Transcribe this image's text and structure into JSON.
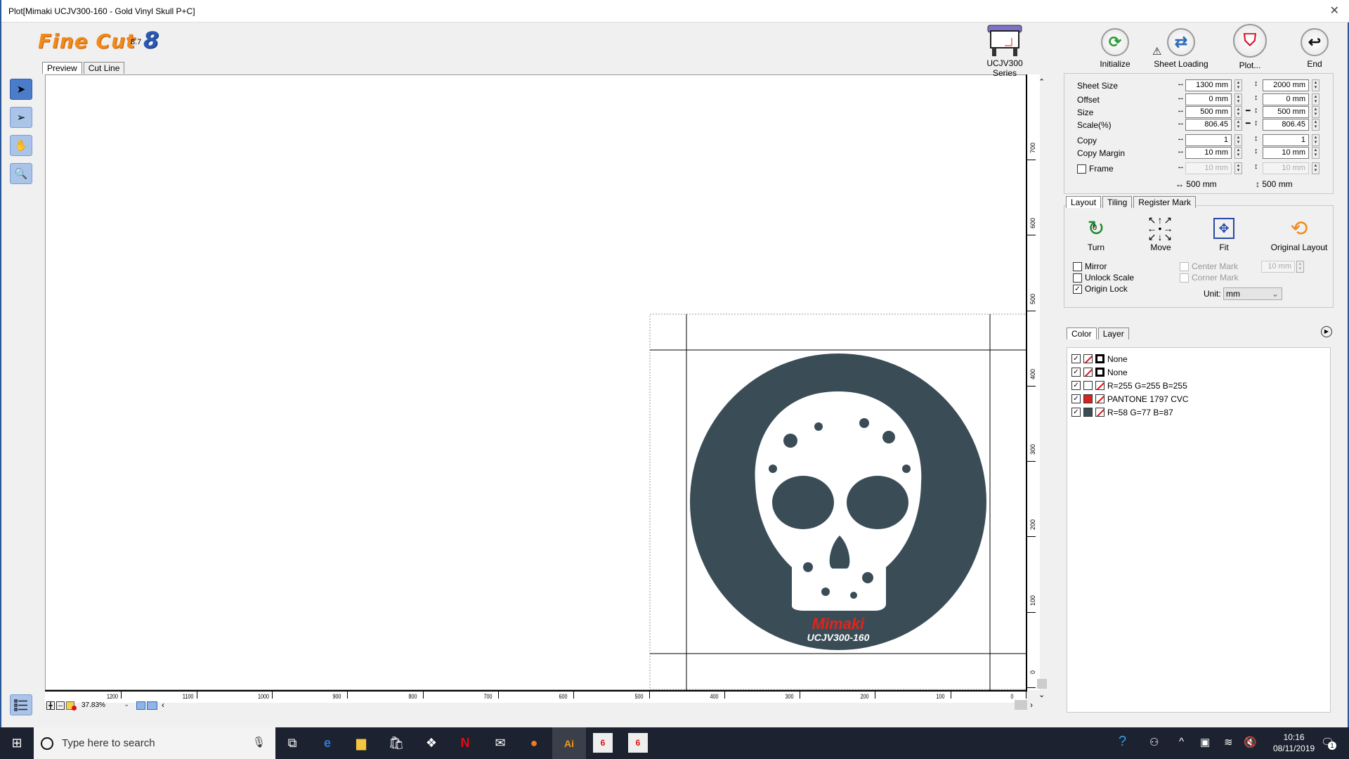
{
  "window": {
    "title": "Plot[Mimaki UCJV300-160 - Gold Vinyl Skull P+C]",
    "close_glyph": "✕"
  },
  "app": {
    "logo_text": "Fine Cut ",
    "logo_number": "8",
    "version": "8.7"
  },
  "view_tabs": [
    {
      "label": "Preview",
      "active": true
    },
    {
      "label": "Cut Line",
      "active": false
    }
  ],
  "left_tools": [
    {
      "name": "select-tool",
      "icon": "arrow-pointer",
      "selected": true
    },
    {
      "name": "direct-select-tool",
      "icon": "arrow-pointer-outline",
      "selected": false
    },
    {
      "name": "hand-tool",
      "icon": "hand",
      "selected": false
    },
    {
      "name": "zoom-tool",
      "icon": "magnifier",
      "selected": false
    }
  ],
  "device": {
    "label": "UCJV300 Series"
  },
  "top_buttons": [
    {
      "label": "Initialize",
      "icon": "refresh-icon",
      "color": "#2e9d3a"
    },
    {
      "label": "Sheet Loading",
      "icon": "swap-arrows-icon",
      "color": "#2f6db8",
      "warning": true
    },
    {
      "label": "Plot...",
      "icon": "plot-icon",
      "color": "#d3122c"
    },
    {
      "label": "End",
      "icon": "return-arrow-icon",
      "color": "#111111"
    }
  ],
  "settings": {
    "rows": [
      {
        "label": "Sheet Size",
        "h": "1300 mm",
        "v": "2000 mm",
        "link": false,
        "disabled": false
      },
      {
        "label": "Offset",
        "h": "0 mm",
        "v": "0 mm",
        "link": false,
        "disabled": false
      },
      {
        "label": "Size",
        "h": "500 mm",
        "v": "500 mm",
        "link": true,
        "disabled": false
      },
      {
        "label": "Scale(%)",
        "h": "806.45",
        "v": "806.45",
        "link": true,
        "disabled": false
      },
      {
        "label": "Copy",
        "h": "1",
        "v": "1",
        "link": false,
        "disabled": false
      },
      {
        "label": "Copy Margin",
        "h": "10 mm",
        "v": "10 mm",
        "link": false,
        "disabled": false
      },
      {
        "label": "Frame",
        "h": "10 mm",
        "v": "10 mm",
        "link": false,
        "disabled": true,
        "checkbox": true,
        "checked": false
      }
    ],
    "total_h": "↔ 500 mm",
    "total_v": "↕ 500 mm"
  },
  "layout_tabs": [
    {
      "label": "Layout",
      "active": true
    },
    {
      "label": "Tiling",
      "active": false
    },
    {
      "label": "Register Mark",
      "active": false
    }
  ],
  "layout_buttons": [
    {
      "label": "Turn",
      "badge": "0"
    },
    {
      "label": "Move"
    },
    {
      "label": "Fit"
    },
    {
      "label": "Original Layout"
    }
  ],
  "layout_options": [
    {
      "label": "Mirror",
      "checked": false
    },
    {
      "label": "Unlock Scale",
      "checked": false
    },
    {
      "label": "Origin Lock",
      "checked": true
    }
  ],
  "mark_options": [
    {
      "label": "Center Mark",
      "checked": false,
      "disabled": true
    },
    {
      "label": "Corner Mark",
      "checked": false,
      "disabled": true
    }
  ],
  "mark_margin": "10 mm",
  "unit": {
    "label": "Unit:",
    "value": "mm"
  },
  "color_tabs": [
    {
      "label": "Color",
      "active": true
    },
    {
      "label": "Layer",
      "active": false
    }
  ],
  "colors": [
    {
      "name": "None",
      "visible": true,
      "fill": "none",
      "stroke": "#000000"
    },
    {
      "name": "None",
      "visible": true,
      "fill": "none",
      "stroke": "#000000"
    },
    {
      "name": "R=255 G=255 B=255",
      "visible": true,
      "fill": "#ffffff",
      "stroke": "none"
    },
    {
      "name": "PANTONE 1797 CVC",
      "visible": true,
      "fill": "#d8231e",
      "stroke": "none"
    },
    {
      "name": "R=58 G=77 B=87",
      "visible": true,
      "fill": "#3a4d57",
      "stroke": "none"
    }
  ],
  "canvas": {
    "artwork_color": "#3a4d57",
    "brand_text": "Mimaki",
    "brand_color": "#e3241b",
    "model_text": "UCJV300-160",
    "h_ruler_labels": [
      "1200",
      "1100",
      "1000",
      "900",
      "800",
      "700",
      "600",
      "500",
      "400",
      "300",
      "200",
      "100",
      "0"
    ],
    "v_ruler_labels": [
      "700",
      "600",
      "500",
      "400",
      "300",
      "200",
      "100",
      "0"
    ],
    "zoom_level": "37.83%"
  },
  "taskbar": {
    "search_placeholder": "Type here to search",
    "time": "10:16",
    "date": "08/11/2019",
    "notification_count": "1"
  }
}
